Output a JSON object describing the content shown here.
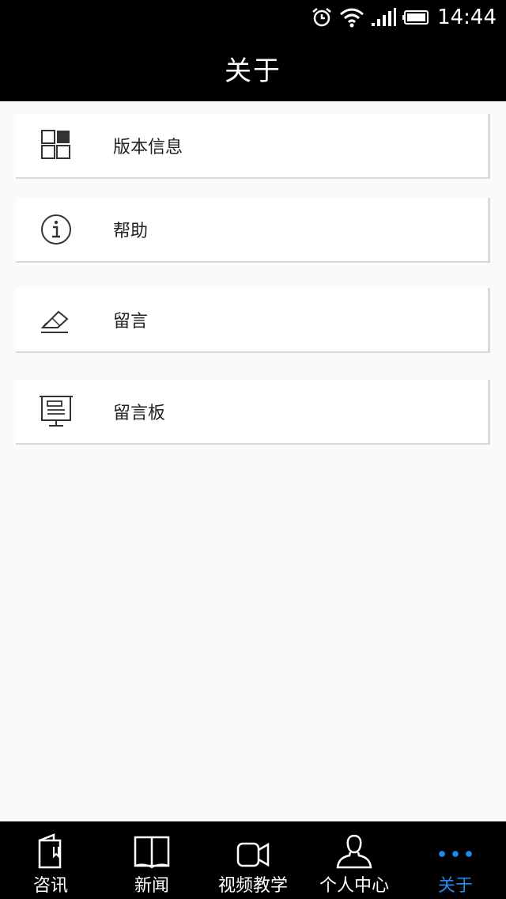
{
  "status_bar": {
    "time": "14:44",
    "icons": [
      "alarm-icon",
      "wifi-icon",
      "signal-icon",
      "battery-icon"
    ]
  },
  "header": {
    "title": "关于"
  },
  "menu": {
    "items": [
      {
        "label": "版本信息",
        "icon": "version-info-icon"
      },
      {
        "label": "帮助",
        "icon": "info-icon"
      },
      {
        "label": "留言",
        "icon": "edit-icon"
      },
      {
        "label": "留言板",
        "icon": "message-board-icon"
      }
    ]
  },
  "tabs": {
    "items": [
      {
        "label": "咨讯",
        "icon": "document-icon"
      },
      {
        "label": "新闻",
        "icon": "book-icon"
      },
      {
        "label": "视频教学",
        "icon": "video-camera-icon"
      },
      {
        "label": "个人中心",
        "icon": "user-icon"
      },
      {
        "label": "关于",
        "icon": "more-icon",
        "active": true
      }
    ]
  },
  "colors": {
    "active_tab": "#1e8cf0",
    "bar_background": "#000000",
    "page_background": "#f9fafc"
  }
}
